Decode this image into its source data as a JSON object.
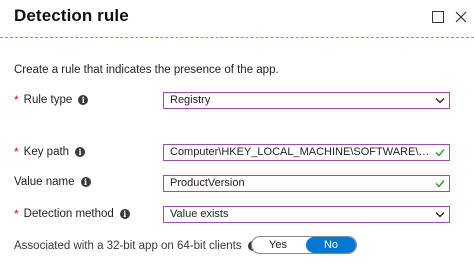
{
  "header": {
    "title": "Detection rule"
  },
  "description": "Create a rule that indicates the presence of the app.",
  "colors": {
    "accent": "#0078d4",
    "highlight_border": "#a347c0",
    "required": "#c50f1f",
    "valid_check": "#2e9a2e"
  },
  "fields": {
    "rule_type": {
      "required_mark": "*",
      "label": "Rule type",
      "value": "Registry"
    },
    "key_path": {
      "required_mark": "*",
      "label": "Key path",
      "value": "Computer\\HKEY_LOCAL_MACHINE\\SOFTWARE\\Microsoft..."
    },
    "value_name": {
      "label": "Value name",
      "value": "ProductVersion"
    },
    "detection_method": {
      "required_mark": "*",
      "label": "Detection method",
      "value": "Value exists"
    },
    "associated_32bit": {
      "label": "Associated with a 32-bit app on 64-bit clients",
      "options": [
        "Yes",
        "No"
      ],
      "selected": "No"
    }
  },
  "icons": {
    "info": "info-icon",
    "maximize": "maximize-icon",
    "close": "close-icon",
    "chevron": "chevron-down-icon",
    "check": "checkmark-icon",
    "info_glyph": "i"
  }
}
